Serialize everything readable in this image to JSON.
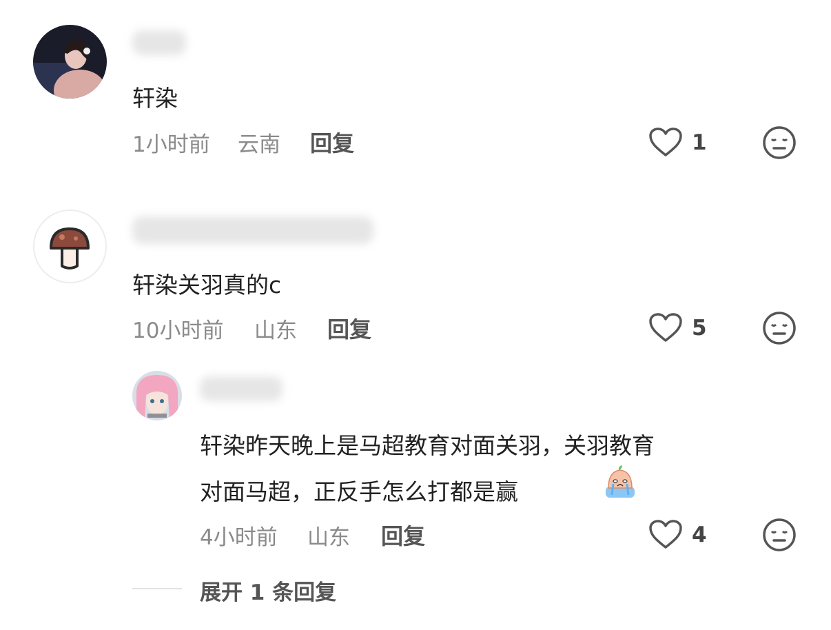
{
  "comments": [
    {
      "content": "轩染",
      "time": "1小时前",
      "location": "云南",
      "reply_label": "回复",
      "likes": "1",
      "avatar_icon": "girl-photo-avatar"
    },
    {
      "content": "轩染关羽真的c",
      "time": "10小时前",
      "location": "山东",
      "reply_label": "回复",
      "likes": "5",
      "avatar_icon": "mushroom-avatar"
    }
  ],
  "reply": {
    "content_line1": "轩染昨天晚上是马超教育对面关羽，关羽教育",
    "content_line2": "对面马超，正反手怎么打都是赢",
    "emoji_icon": "crying-peach-emoji",
    "time": "4小时前",
    "location": "山东",
    "reply_label": "回复",
    "likes": "4",
    "avatar_icon": "pink-hair-anime-avatar"
  },
  "expand_label": "展开 1 条回复",
  "colors": {
    "meta": "#8a8a8a",
    "icon": "#555555"
  }
}
